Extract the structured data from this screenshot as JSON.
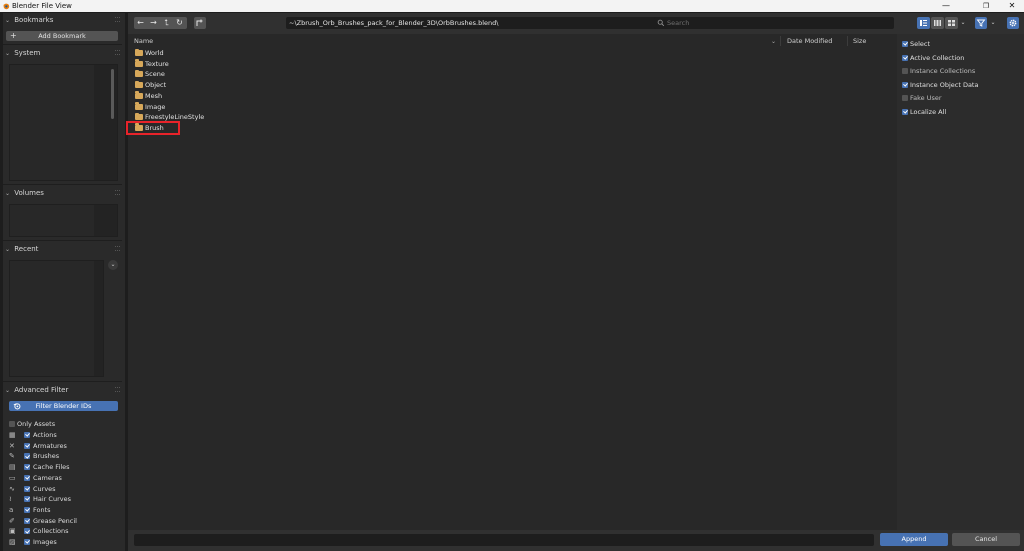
{
  "window": {
    "title": "Blender File View",
    "minimize": "—",
    "maximize": "❐",
    "close": "✕"
  },
  "sidebar": {
    "bookmarks": {
      "header": "Bookmarks",
      "add_label": "Add Bookmark"
    },
    "system": {
      "header": "System"
    },
    "volumes": {
      "header": "Volumes"
    },
    "recent": {
      "header": "Recent"
    },
    "advanced_filter": {
      "header": "Advanced Filter",
      "filter_button": "Filter Blender IDs",
      "only_assets": "Only Assets",
      "only_assets_checked": false,
      "items": [
        {
          "label": "Actions",
          "icon": "action-icon",
          "checked": true
        },
        {
          "label": "Armatures",
          "icon": "armature-icon",
          "checked": true
        },
        {
          "label": "Brushes",
          "icon": "brush-icon",
          "checked": true
        },
        {
          "label": "Cache Files",
          "icon": "cache-file-icon",
          "checked": true
        },
        {
          "label": "Cameras",
          "icon": "camera-icon",
          "checked": true
        },
        {
          "label": "Curves",
          "icon": "curve-icon",
          "checked": true
        },
        {
          "label": "Hair Curves",
          "icon": "hair-curve-icon",
          "checked": true
        },
        {
          "label": "Fonts",
          "icon": "font-icon",
          "checked": true
        },
        {
          "label": "Grease Pencil",
          "icon": "grease-pencil-icon",
          "checked": true
        },
        {
          "label": "Collections",
          "icon": "collection-icon",
          "checked": true
        },
        {
          "label": "Images",
          "icon": "image-icon",
          "checked": true
        }
      ]
    }
  },
  "toolbar": {
    "back": "←",
    "forward": "→",
    "parent": "⮤",
    "refresh": "↻",
    "path": "~\\Zbrush_Orb_Brushes_pack_for_Blender_3D\\OrbBrushes.blend\\",
    "search_placeholder": "Search"
  },
  "file_list": {
    "columns": {
      "name": "Name",
      "date": "Date Modified",
      "size": "Size"
    },
    "rows": [
      "World",
      "Texture",
      "Scene",
      "Object",
      "Mesh",
      "Image",
      "FreestyleLineStyle",
      "Brush"
    ],
    "highlighted": "Brush"
  },
  "options": [
    {
      "label": "Select",
      "checked": true
    },
    {
      "label": "Active Collection",
      "checked": true
    },
    {
      "label": "Instance Collections",
      "checked": false
    },
    {
      "label": "Instance Object Data",
      "checked": true
    },
    {
      "label": "Fake User",
      "checked": false
    },
    {
      "label": "Localize All",
      "checked": true
    }
  ],
  "footer": {
    "append_label": "Append",
    "cancel_label": "Cancel"
  },
  "colors": {
    "accent": "#4772b3",
    "folder": "#d7a85a",
    "highlight_box": "#e8232a"
  }
}
